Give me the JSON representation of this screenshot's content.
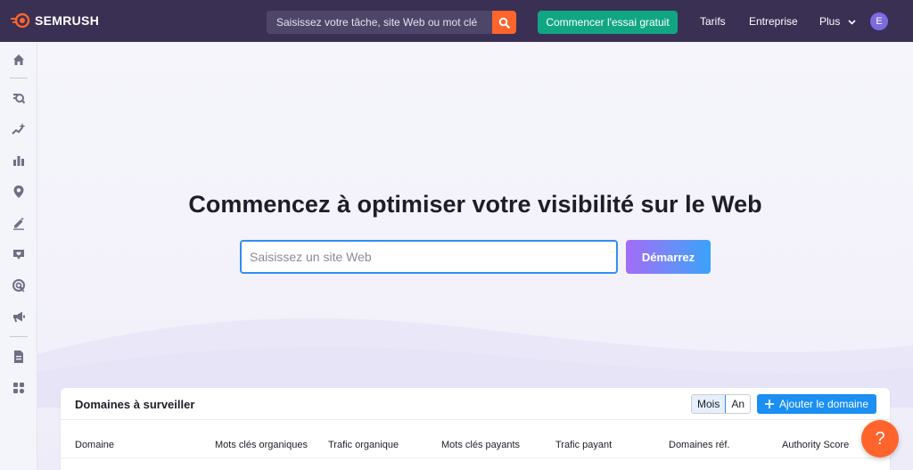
{
  "header": {
    "brand": "SEMRUSH",
    "search_placeholder": "Saisissez votre tâche, site Web ou mot clé",
    "trial_label": "Commencer l'essai gratuit",
    "nav": [
      "Tarifs",
      "Entreprise",
      "Plus"
    ],
    "avatar_initial": "E"
  },
  "sidebar": {
    "icons": [
      "home-icon",
      "seo-icon",
      "trends-icon",
      "analytics-icon",
      "local-icon",
      "content-icon",
      "social-icon",
      "advertising-icon",
      "campaign-icon",
      "reports-icon",
      "apps-icon"
    ]
  },
  "hero": {
    "title": "Commencez à optimiser votre visibilité sur le Web",
    "input_placeholder": "Saisissez un site Web",
    "start_label": "Démarrez"
  },
  "domains_panel": {
    "title": "Domaines à surveiller",
    "toggle": [
      "Mois",
      "An"
    ],
    "toggle_active": "Mois",
    "add_label": "Ajouter le domaine",
    "columns": [
      "Domaine",
      "Mots clés organiques",
      "Trafic organique",
      "Mots clés payants",
      "Trafic payant",
      "Domaines réf.",
      "Authority Score"
    ]
  },
  "help_label": "?",
  "colors": {
    "topbar": "#3a3054",
    "accent_orange": "#ff642d",
    "trial_green": "#11a683",
    "primary_blue": "#1b8ff2"
  }
}
